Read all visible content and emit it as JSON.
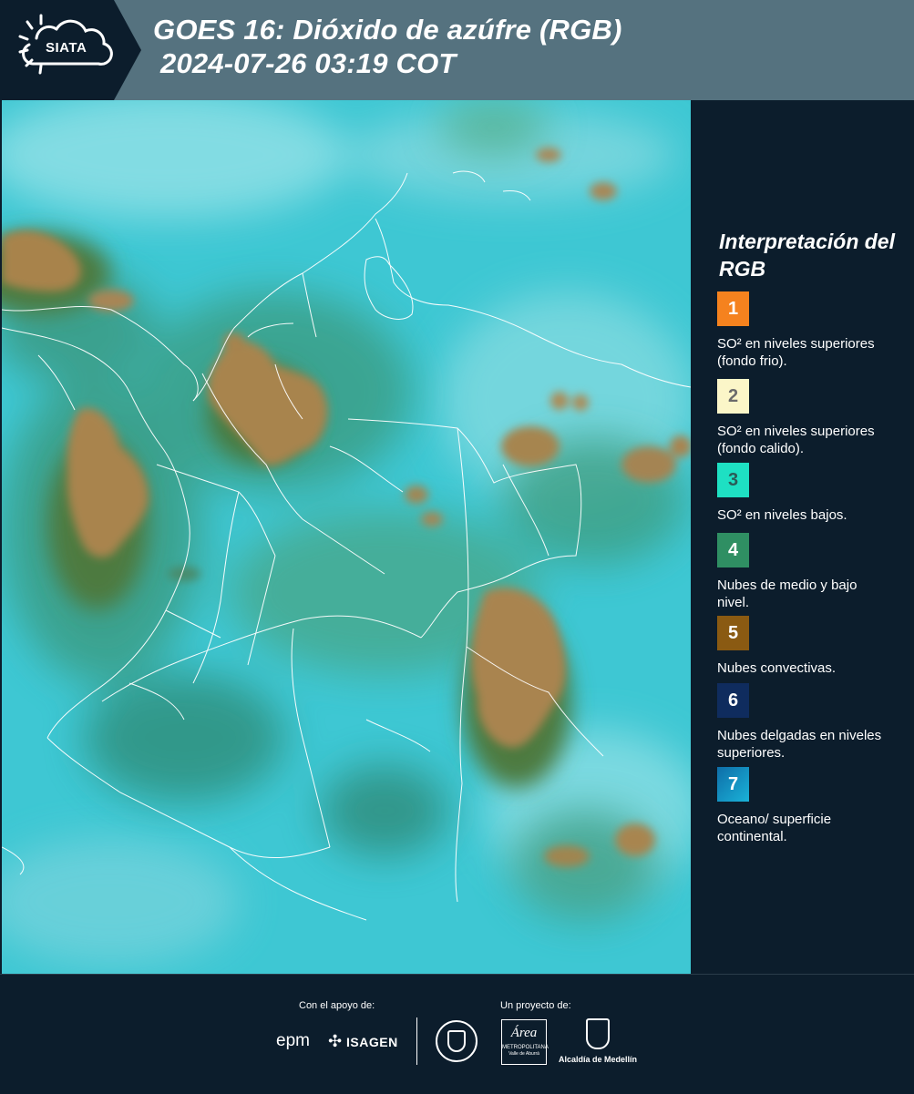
{
  "header": {
    "logo_text": "SIATA",
    "title_line1": "GOES 16: Dióxido de azúfre (RGB)",
    "title_line2": "2024-07-26 03:19 COT"
  },
  "legend": {
    "title": "Interpretación del RGB",
    "items": [
      {
        "number": "1",
        "text": "SO² en niveles superiores (fondo frio).",
        "color": "#f5821e",
        "num_color": "#ffffff"
      },
      {
        "number": "2",
        "text": "SO² en niveles superiores (fondo calido).",
        "color": "#fbf6c8",
        "num_color": "#6b6b6b"
      },
      {
        "number": "3",
        "text": "SO² en niveles bajos.",
        "color": "#1ee0c3",
        "num_color": "#2b5b57"
      },
      {
        "number": "4",
        "text": "Nubes de medio y bajo nivel.",
        "color": "#2f8f63",
        "num_color": "#ffffff"
      },
      {
        "number": "5",
        "text": "Nubes convectivas.",
        "color": "#8a5a12",
        "num_color": "#ffffff"
      },
      {
        "number": "6",
        "text": "Nubes delgadas en niveles superiores.",
        "color": "#0f2c5e",
        "num_color": "#ffffff"
      },
      {
        "number": "7",
        "text": "Oceano/ superficie continental.",
        "color": "#1a8fbf",
        "num_color": "#ffffff"
      }
    ]
  },
  "footer": {
    "support_label": "Con el apoyo de:",
    "project_label": "Un proyecto de:",
    "epm": "epm",
    "isagen": "ISAGEN",
    "metro_line1": "Área",
    "metro_line2": "METROPOLITANA",
    "metro_line3": "Valle de Aburrá",
    "alcaldia": "Alcaldía de Medellín"
  }
}
